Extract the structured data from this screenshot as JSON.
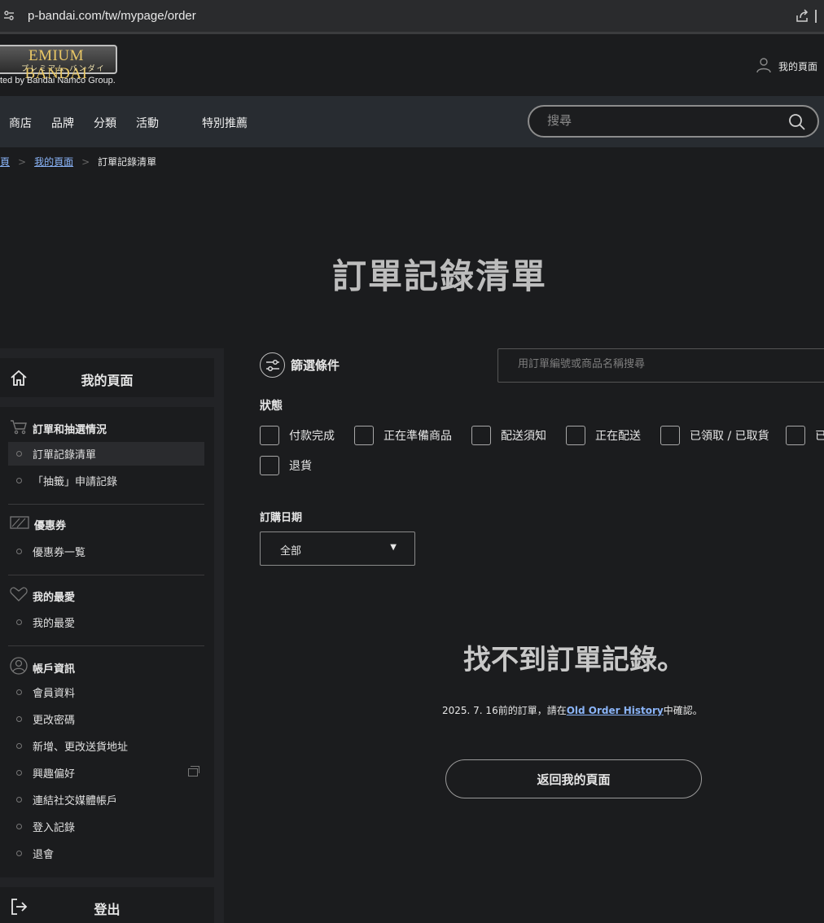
{
  "browser": {
    "url": "p-bandai.com/tw/mypage/order"
  },
  "header": {
    "logo_text": "EMIUM BANDAI",
    "logo_subtext": "プレミアム バンダイ",
    "logo_tagline": "ted by Bandai Namco Group.",
    "mypage_label": "我的頁面"
  },
  "nav": {
    "items": [
      "商店",
      "品牌",
      "分類",
      "活動",
      "特別推薦"
    ],
    "search_placeholder": "搜尋"
  },
  "breadcrumb": {
    "home": "頁",
    "mypage": "我的頁面",
    "current": "訂單記錄清單"
  },
  "page_title": "訂單記錄清單",
  "sidebar": {
    "home_label": "我的頁面",
    "sections": [
      {
        "title": "訂單和抽選情況",
        "links": [
          "訂單記錄清單",
          "「抽籤」申請記錄"
        ]
      },
      {
        "title": "優惠券",
        "links": [
          "優惠券一覧"
        ]
      },
      {
        "title": "我的最愛",
        "links": [
          "我的最愛"
        ]
      },
      {
        "title": "帳戶資訊",
        "links": [
          "會員資料",
          "更改密碼",
          "新增、更改送貨地址",
          "興趣偏好",
          "連結社交媒體帳戶",
          "登入記錄",
          "退會"
        ]
      }
    ],
    "logout_label": "登出"
  },
  "filter": {
    "title": "篩選條件",
    "search_placeholder": "用訂單編號或商品名稱搜尋",
    "status_label": "狀態",
    "statuses": [
      "付款完成",
      "正在準備商品",
      "配送須知",
      "正在配送",
      "已領取 / 已取貨",
      "已",
      "退貨"
    ],
    "date_label": "訂購日期",
    "date_value": "全部"
  },
  "empty": {
    "title": "找不到訂單記錄。",
    "note_prefix": "2025. 7. 16前的訂單，請在",
    "note_link": "Old Order History",
    "note_suffix": "中確認。",
    "back_button": "返回我的頁面"
  },
  "colors": {
    "link": "#8ab4f8",
    "background": "#1b1c1e",
    "nav": "#282c31"
  }
}
